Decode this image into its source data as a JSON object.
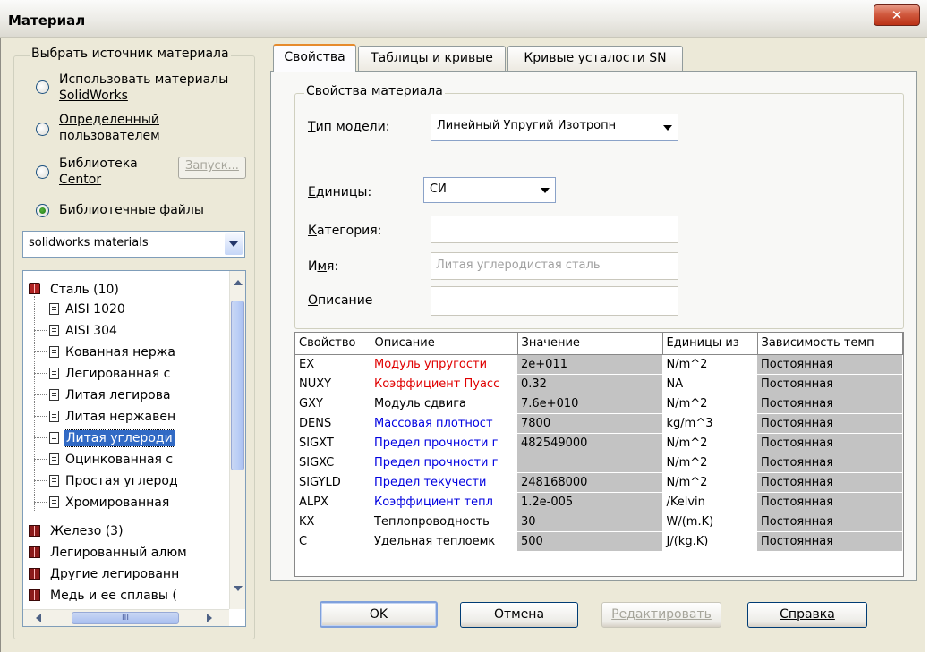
{
  "window": {
    "title": "Материал",
    "close_symbol": "✕"
  },
  "source_group": {
    "legend": "Выбрать источник материала",
    "options": [
      {
        "line1": "Использовать материалы",
        "line2": "SolidWorks",
        "checked": false
      },
      {
        "line1": "Определенный",
        "line2": "пользователем",
        "checked": false
      },
      {
        "line1": "Библиотека",
        "line2": "Centor",
        "checked": false
      },
      {
        "line1": "Библиотечные файлы",
        "line2": "",
        "checked": true
      }
    ],
    "launch_button": "Запуск...",
    "library_select": "solidworks materials",
    "tree": {
      "root": "Сталь (10)",
      "children": [
        "AISI 1020",
        "AISI 304",
        "Кованная нержа",
        "Легированная с",
        "Литая легирова",
        "Литая нержавен",
        "Литая углероди",
        "Оцинкованная с",
        "Простая углерод",
        "Хромированная"
      ],
      "siblings": [
        "Железо (3)",
        "Легированный алюм",
        "Другие легированн",
        "Медь и ее сплавы ("
      ],
      "hscroll_grip": "III"
    }
  },
  "tabs": [
    {
      "label": "Свойства",
      "active": true
    },
    {
      "label": "Таблицы и кривые",
      "active": false
    },
    {
      "label": "Кривые усталости SN",
      "active": false
    }
  ],
  "properties": {
    "legend": "Свойства материала",
    "model_type_label": "Тип модели:",
    "model_type_value": "Линейный Упругий Изотропн",
    "units_label": "Единицы:",
    "units_value": "СИ",
    "category_label": "Категория:",
    "category_value": "",
    "name_label": "Имя:",
    "name_value": "Литая углеродистая сталь",
    "description_label": "Описание",
    "description_value": ""
  },
  "grid": {
    "headers": [
      "Свойство",
      "Описание",
      "Значение",
      "Единицы из",
      "Зависимость темп"
    ],
    "rows": [
      {
        "prop": "EX",
        "desc": "Модуль упругости",
        "color": "red",
        "value": "2e+011",
        "unit": "N/m^2",
        "dep": "Постоянная"
      },
      {
        "prop": "NUXY",
        "desc": "Коэффициент Пуасс",
        "color": "red",
        "value": "0.32",
        "unit": "NA",
        "dep": "Постоянная"
      },
      {
        "prop": "GXY",
        "desc": "Модуль сдвига",
        "color": "black",
        "value": "7.6e+010",
        "unit": "N/m^2",
        "dep": "Постоянная"
      },
      {
        "prop": "DENS",
        "desc": "Массовая плотност",
        "color": "blue",
        "value": "7800",
        "unit": "kg/m^3",
        "dep": "Постоянная"
      },
      {
        "prop": "SIGXT",
        "desc": "Предел прочности г",
        "color": "blue",
        "value": "482549000",
        "unit": "N/m^2",
        "dep": "Постоянная"
      },
      {
        "prop": "SIGXC",
        "desc": "Предел прочности г",
        "color": "blue",
        "value": "",
        "unit": "N/m^2",
        "dep": "Постоянная"
      },
      {
        "prop": "SIGYLD",
        "desc": "Предел текучести",
        "color": "blue",
        "value": "248168000",
        "unit": "N/m^2",
        "dep": "Постоянная"
      },
      {
        "prop": "ALPX",
        "desc": "Коэффициент тепл",
        "color": "blue",
        "value": "1.2e-005",
        "unit": "/Kelvin",
        "dep": "Постоянная"
      },
      {
        "prop": "KX",
        "desc": "Теплопроводность",
        "color": "black",
        "value": "30",
        "unit": "W/(m.K)",
        "dep": "Постоянная"
      },
      {
        "prop": "C",
        "desc": "Удельная теплоемк",
        "color": "black",
        "value": "500",
        "unit": "J/(kg.K)",
        "dep": "Постоянная"
      }
    ]
  },
  "buttons": {
    "ok": "OK",
    "cancel": "Отмена",
    "edit": "Редактировать",
    "help": "Справка"
  }
}
